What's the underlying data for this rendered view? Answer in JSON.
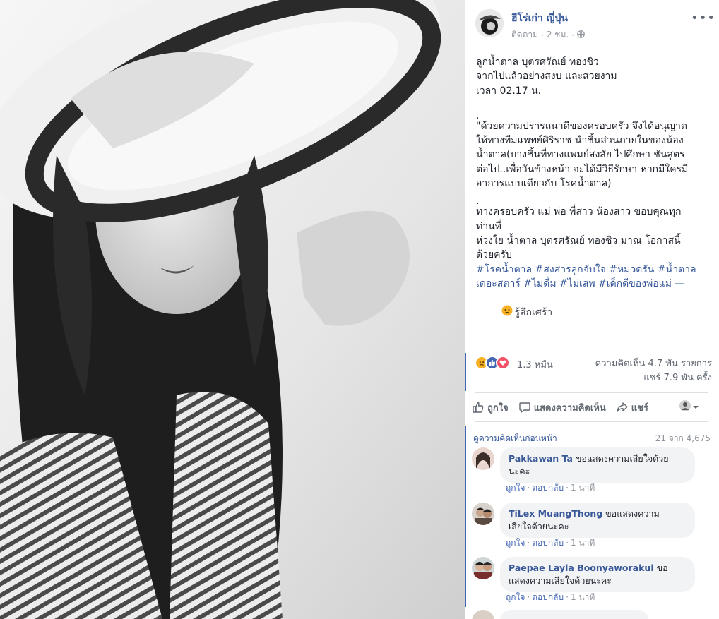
{
  "post": {
    "author": "ฮีโร่เก่า ญี่ปุ่น",
    "follow": "ติดตาม",
    "time": "2 ชม.",
    "dot": "·",
    "text_lines": [
      "ลูกน้ำตาล บุตรศรัณย์ ทองชิว",
      "จากไปแล้วอย่างสงบ และสวยงาม",
      "เวลา 02.17 น.",
      ".",
      "\"ด้วยความปรารถนาดีของครอบครัว จึงได้อนุญาต",
      "ให้ทางทีมแพทย์ศิริราช นำชิ้นส่วนภายในของน้อง",
      "น้ำตาล(บางชิ้นที่ทางแพมย์สงสัย ไปศึกษา ชันสูตร",
      "ต่อไป..เพื่อวันข้างหน้า จะได้มีวิธีรักษา หากมีใครมี",
      "อาการแบบเดียวกับ โรคน้ำตาล)",
      ".",
      "ทางครอบครัว แม่ พ่อ พี่สาว น้องสาว ขอบคุณทุก",
      "ท่านที่",
      "ห่วงใย น้ำตาล บุตรศรัณย์ ทองชิว มาณ โอกาสนี้",
      "ด้วยครับ"
    ],
    "hashtags_line1": "#โรคน้ำตาล #สงสารลูกจับใจ #หมวดรัน #น้ำตาล",
    "hashtags_line2": "เดอะสตาร์ #ไม่ดื่ม #ไม่เสพ #เด็กดีของพ่อแม่ —",
    "feeling": "รู้สึกเศร้า",
    "feeling_icon": "sad-face-icon"
  },
  "reactions": {
    "count": "1.3 หมื่น",
    "comments": "ความคิดเห็น 4.7 พัน รายการ",
    "shares": "แชร์ 7.9 พัน ครั้ง",
    "colors": {
      "like": "#4267b2",
      "love": "#f25268",
      "sad": "#f7b125"
    }
  },
  "actions": {
    "like": "ถูกใจ",
    "comment": "แสดงความคิดเห็น",
    "share": "แชร์"
  },
  "comments_header": {
    "previous": "ดูความคิดเห็นก่อนหน้า",
    "count": "21 จาก 4,675"
  },
  "comments": [
    {
      "name": "Pakkawan Ta",
      "text_1": "ขอแสดงความเสียใจด้วย",
      "text_2": "นะคะ",
      "like": "ถูกใจ",
      "reply": "ตอบกลับ",
      "time": "1 นาที"
    },
    {
      "name": "TiLex MuangThong",
      "text_1": "ขอแสดงความ",
      "text_2": "เสียใจด้วยนะคะ",
      "like": "ถูกใจ",
      "reply": "ตอบกลับ",
      "time": "1 นาที"
    },
    {
      "name": "Paepae Layla Boonyaworakul",
      "text_1": "ขอ",
      "text_2": "แสดงความเสียใจด้วยนะคะ",
      "like": "ถูกใจ",
      "reply": "ตอบกลับ",
      "time": "1 นาที"
    }
  ],
  "accent": "#365899"
}
